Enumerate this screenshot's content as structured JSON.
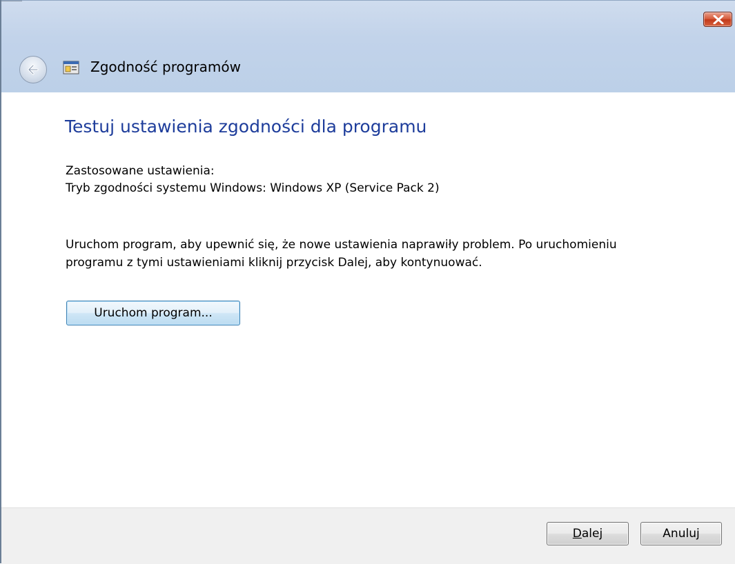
{
  "window": {
    "title": "Zgodność programów",
    "accent_color": "#1e3d9b"
  },
  "icons": {
    "back": "back-arrow-icon",
    "app": "program-compatibility-icon",
    "close": "close-icon"
  },
  "content": {
    "heading": "Testuj ustawienia zgodności dla programu",
    "settings_label": "Zastosowane ustawienia:",
    "settings_value": "Tryb zgodności systemu Windows: Windows XP (Service Pack 2)",
    "description_line1": "Uruchom program, aby upewnić się, że nowe ustawienia naprawiły problem. Po uruchomieniu",
    "description_line2": "programu z tymi ustawieniami kliknij przycisk Dalej, aby kontynuować.",
    "run_button_label": "Uruchom program..."
  },
  "footer": {
    "next_label": "Dalej",
    "cancel_label": "Anuluj"
  }
}
